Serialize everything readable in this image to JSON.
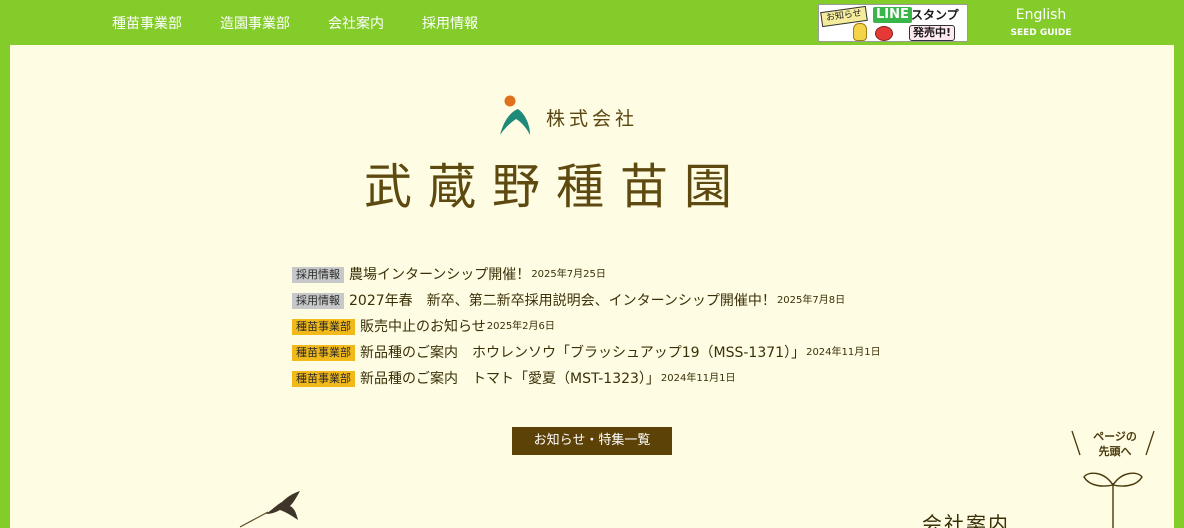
{
  "nav": {
    "items": [
      {
        "label": "種苗事業部"
      },
      {
        "label": "造園事業部"
      },
      {
        "label": "会社案内"
      },
      {
        "label": "採用情報"
      }
    ]
  },
  "banner": {
    "notice": "お知らせ",
    "line": "LINE",
    "stamp": "スタンプ",
    "sale": "発売中!"
  },
  "lang": {
    "english": "English",
    "seed_guide": "SEED GUIDE"
  },
  "brand": {
    "company_type": "株式会社",
    "company_name": "武蔵野種苗園",
    "mark_colors": {
      "dot": "#e0701c",
      "leaf": "#1e8a7a"
    }
  },
  "news": [
    {
      "category": "採用情報",
      "kind": "recruit",
      "title": "農場インターンシップ開催！",
      "date": "2025年7月25日"
    },
    {
      "category": "採用情報",
      "kind": "recruit",
      "title": "2027年春　新卒、第二新卒採用説明会、インターンシップ開催中！",
      "date": "2025年7月8日"
    },
    {
      "category": "種苗事業部",
      "kind": "seed",
      "title": "販売中止のお知らせ",
      "date": "2025年2月6日"
    },
    {
      "category": "種苗事業部",
      "kind": "seed",
      "title": "新品種のご案内　ホウレンソウ「ブラッシュアップ19（MSS-1371）」",
      "date": "2024年11月1日"
    },
    {
      "category": "種苗事業部",
      "kind": "seed",
      "title": "新品種のご案内　トマト「愛夏（MST-1323）」",
      "date": "2024年11月1日"
    }
  ],
  "more_button": {
    "label": "お知らせ・特集一覧"
  },
  "pagetop": {
    "line1": "ページの",
    "line2": "先頭へ"
  },
  "section_peek": {
    "title": "会社案内"
  },
  "colors": {
    "header_green": "#84cc2a",
    "panel_cream": "#fefce2",
    "brand_brown": "#5e4a10",
    "badge_recruit": "#c7c8c9",
    "badge_seed": "#f2b91b"
  }
}
